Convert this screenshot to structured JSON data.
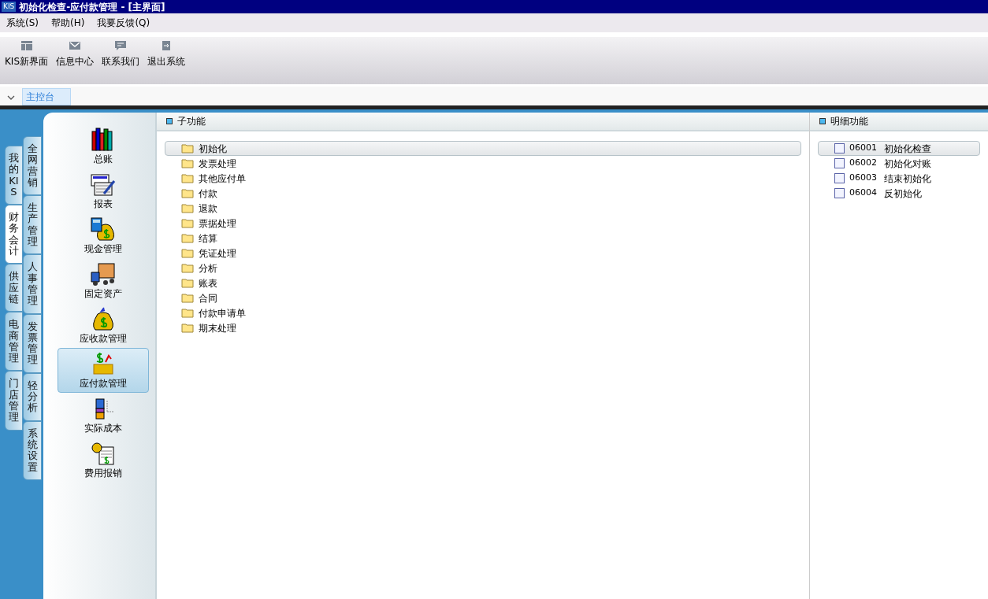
{
  "window": {
    "logo": "KIS",
    "title": "初始化检查-应付款管理 - [主界面]"
  },
  "menu": [
    "系统(S)",
    "帮助(H)",
    "我要反馈(Q)"
  ],
  "toolbar": [
    {
      "label": "KIS新界面",
      "kind": "layout"
    },
    {
      "label": "信息中心",
      "kind": "mail"
    },
    {
      "label": "联系我们",
      "kind": "chat"
    },
    {
      "label": "退出系统",
      "kind": "exit"
    }
  ],
  "tabs": [
    {
      "label": "主控台",
      "selected": true
    }
  ],
  "side_tabs_outer": [
    {
      "label": "我的KIS",
      "selected": false
    },
    {
      "label": "财务会计",
      "selected": true
    },
    {
      "label": "供应链",
      "selected": false
    },
    {
      "label": "电商管理",
      "selected": false
    },
    {
      "label": "门店管理",
      "selected": false
    }
  ],
  "side_tabs_inner": [
    {
      "label": "全网营销",
      "selected": false
    },
    {
      "label": "生产管理",
      "selected": false
    },
    {
      "label": "人事管理",
      "selected": false
    },
    {
      "label": "发票管理",
      "selected": false
    },
    {
      "label": "轻分析",
      "selected": false
    },
    {
      "label": "系统设置",
      "selected": false
    }
  ],
  "modules": [
    {
      "label": "总账",
      "kind": "books",
      "selected": false
    },
    {
      "label": "报表",
      "kind": "report",
      "selected": false
    },
    {
      "label": "现金管理",
      "kind": "cash",
      "selected": false
    },
    {
      "label": "固定资产",
      "kind": "truck",
      "selected": false
    },
    {
      "label": "应收款管理",
      "kind": "moneybag",
      "selected": false
    },
    {
      "label": "应付款管理",
      "kind": "payable",
      "selected": true
    },
    {
      "label": "实际成本",
      "kind": "cost",
      "selected": false
    },
    {
      "label": "费用报销",
      "kind": "expense",
      "selected": false
    }
  ],
  "sub_functions": {
    "title": "子功能",
    "items": [
      {
        "label": "初始化",
        "selected": true
      },
      {
        "label": "发票处理",
        "selected": false
      },
      {
        "label": "其他应付单",
        "selected": false
      },
      {
        "label": "付款",
        "selected": false
      },
      {
        "label": "退款",
        "selected": false
      },
      {
        "label": "票据处理",
        "selected": false
      },
      {
        "label": "结算",
        "selected": false
      },
      {
        "label": "凭证处理",
        "selected": false
      },
      {
        "label": "分析",
        "selected": false
      },
      {
        "label": "账表",
        "selected": false
      },
      {
        "label": "合同",
        "selected": false
      },
      {
        "label": "付款申请单",
        "selected": false
      },
      {
        "label": "期末处理",
        "selected": false
      }
    ]
  },
  "detail_functions": {
    "title": "明细功能",
    "items": [
      {
        "code": "06001",
        "label": "初始化检查",
        "selected": true
      },
      {
        "code": "06002",
        "label": "初始化对账",
        "selected": false
      },
      {
        "code": "06003",
        "label": "结束初始化",
        "selected": false
      },
      {
        "code": "06004",
        "label": "反初始化",
        "selected": false
      }
    ]
  }
}
